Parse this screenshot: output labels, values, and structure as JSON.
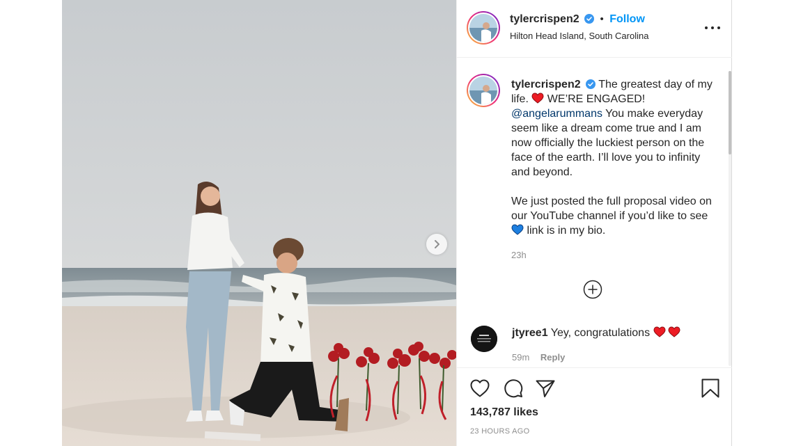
{
  "post": {
    "username": "tylercrispen2",
    "follow_label": "Follow",
    "dot": "•",
    "location": "Hilton Head Island, South Carolina"
  },
  "caption": {
    "username": "tylercrispen2",
    "text_part1": " The greatest day of my life. ",
    "text_part2": " WE’RE ENGAGED! ",
    "mention": "@angelarummans",
    "text_part3": " You make everyday seem like a dream come true and I am now officially the luckiest person on the face of the earth. I’ll love you to infinity and beyond.",
    "text_part4": "We just posted the full proposal video on our YouTube channel if you’d like to see ",
    "text_part5": " link is in my bio.",
    "time": "23h"
  },
  "comment": {
    "username": "jtyree1",
    "text": " Yey, congratulations ",
    "time": "59m",
    "reply_label": "Reply"
  },
  "footer": {
    "likes": "143,787 likes",
    "timestamp": "23 HOURS AGO"
  },
  "icons": {
    "verified": "verified-badge-icon",
    "more": "more-options-icon",
    "next": "chevron-right-icon",
    "plus": "load-more-comments-icon",
    "like": "heart-outline-icon",
    "comment": "comment-bubble-icon",
    "share": "paper-plane-icon",
    "save": "bookmark-icon"
  },
  "colors": {
    "accent": "#0095f6",
    "mention": "#00376b",
    "heart_red": "#ed1c24",
    "heart_blue": "#1d7fe0",
    "muted": "#8e8e8e"
  }
}
